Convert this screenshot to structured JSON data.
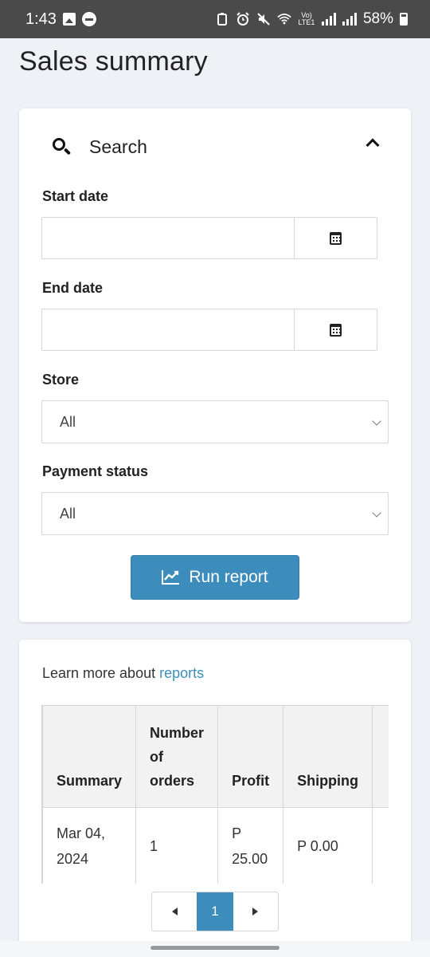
{
  "status_bar": {
    "time": "1:43",
    "volte": "Vo) LTE1",
    "battery_percent": "58%"
  },
  "page": {
    "title": "Sales summary"
  },
  "search_panel": {
    "title": "Search",
    "start_date": {
      "label": "Start date",
      "value": ""
    },
    "end_date": {
      "label": "End date",
      "value": ""
    },
    "store": {
      "label": "Store",
      "selected": "All"
    },
    "payment_status": {
      "label": "Payment status",
      "selected": "All"
    },
    "run_button": "Run report"
  },
  "results": {
    "learn_more_text": "Learn more about",
    "learn_more_link": "reports",
    "table": {
      "headers": [
        "Summary",
        "Number of orders",
        "Profit",
        "Shipping"
      ],
      "rows": [
        {
          "summary": "Mar 04, 2024",
          "orders": "1",
          "profit": "P 25.00",
          "shipping": "P 0.00"
        }
      ]
    },
    "pagination": {
      "current_page": "1"
    }
  },
  "colors": {
    "accent": "#3c8dbc",
    "status_bar": "#4a4a4a",
    "background": "#eef1f5"
  }
}
